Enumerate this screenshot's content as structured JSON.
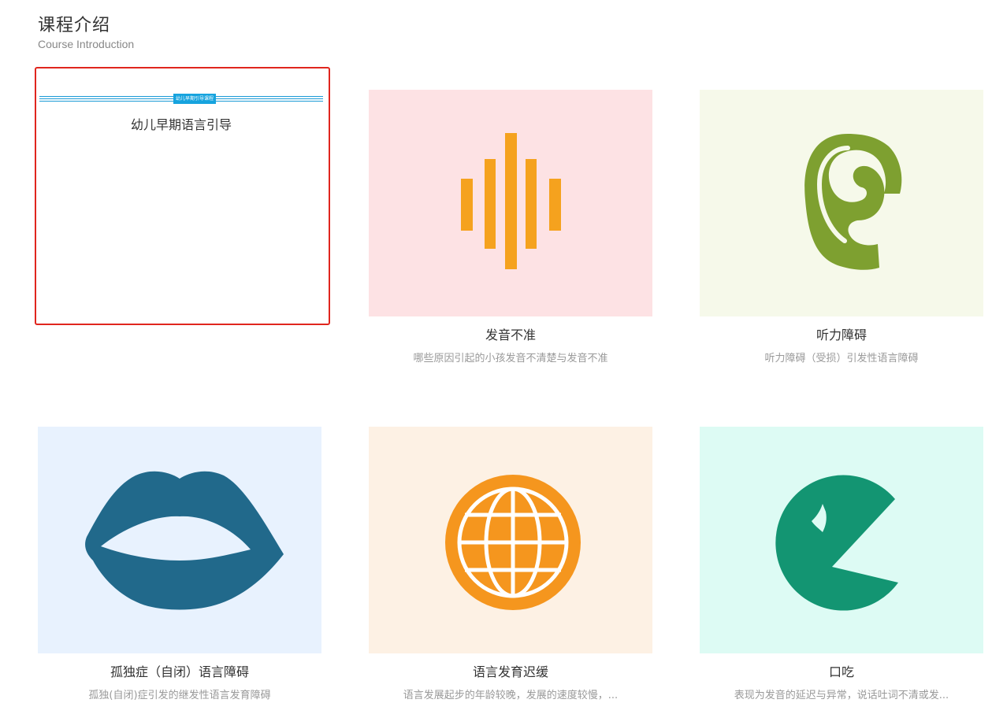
{
  "header": {
    "title": "课程介绍",
    "subtitle": "Course Introduction"
  },
  "featured": {
    "banner_text": "幼儿早期引导课程",
    "title": "幼儿早期语言引导"
  },
  "courses": [
    {
      "title": "发音不准",
      "desc": "哪些原因引起的小孩发音不清楚与发音不准",
      "bg": "#fde2e4",
      "icon": "sound-wave-icon",
      "color": "#f5a21e"
    },
    {
      "title": "听力障碍",
      "desc": "听力障碍（受损）引发性语言障碍",
      "bg": "#f6f9ea",
      "icon": "ear-icon",
      "color": "#7ea030"
    },
    {
      "title": "孤独症（自闭）语言障碍",
      "desc": "孤独(自闭)症引发的继发性语言发育障碍",
      "bg": "#e8f2fe",
      "icon": "lips-icon",
      "color": "#21698b"
    },
    {
      "title": "语言发育迟缓",
      "desc": "语言发展起步的年龄较晚，发展的速度较慢，...",
      "bg": "#fdf1e4",
      "icon": "globe-icon",
      "color": "#f5961e"
    },
    {
      "title": "口吃",
      "desc": "表现为发音的延迟与异常，说话吐词不清或发...",
      "bg": "#ddfbf4",
      "icon": "pacman-icon",
      "color": "#139572"
    }
  ]
}
